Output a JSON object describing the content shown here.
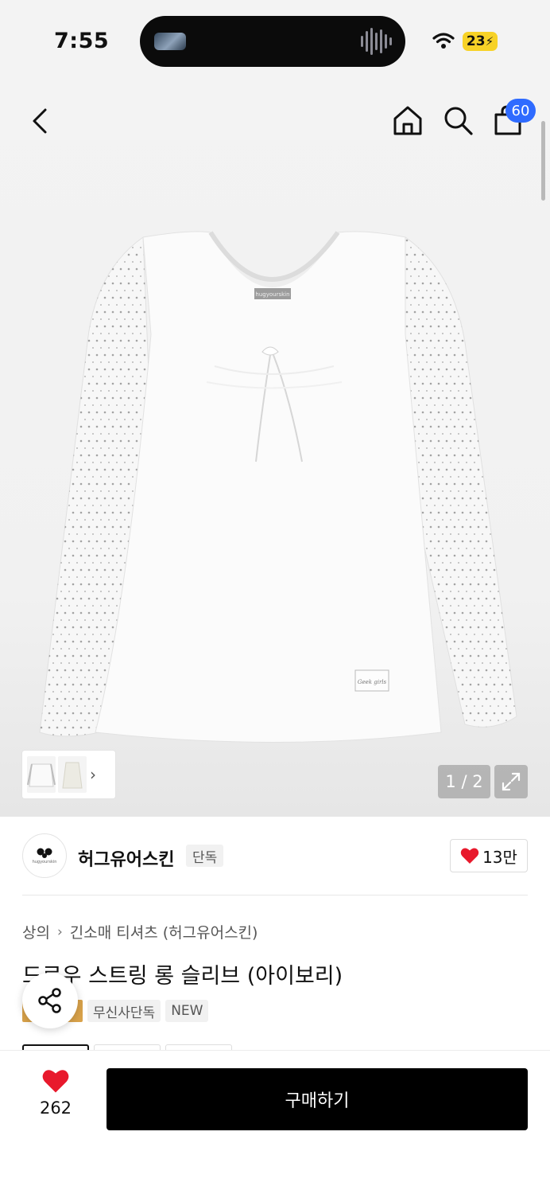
{
  "status_bar": {
    "time": "7:55",
    "battery": "23"
  },
  "header": {
    "cart_count": "60"
  },
  "gallery": {
    "counter": "1 / 2",
    "label_tag": "hugyourskin",
    "patch_text": "Geek girls"
  },
  "brand": {
    "logo_text": "hugyourskin",
    "name": "허그유어스킨",
    "tag": "단독",
    "likes": "13만"
  },
  "breadcrumb": {
    "level1": "상의",
    "level2": "긴소매 티셔츠 (허그유어스킨)"
  },
  "product": {
    "title": "드로우 스트링 롱 슬리브 (아이보리)",
    "badges": [
      "무신사단독",
      "NEW"
    ]
  },
  "bottom": {
    "wish_count": "262",
    "buy_label": "구매하기"
  },
  "colors": {
    "accent": "#2f6bff",
    "heart": "#e8192c",
    "buy_bg": "#000000",
    "exclusive": "#d9a24a"
  },
  "icons": [
    "back-icon",
    "home-icon",
    "search-icon",
    "cart-icon",
    "expand-icon",
    "share-icon",
    "heart-icon",
    "wifi-icon"
  ]
}
